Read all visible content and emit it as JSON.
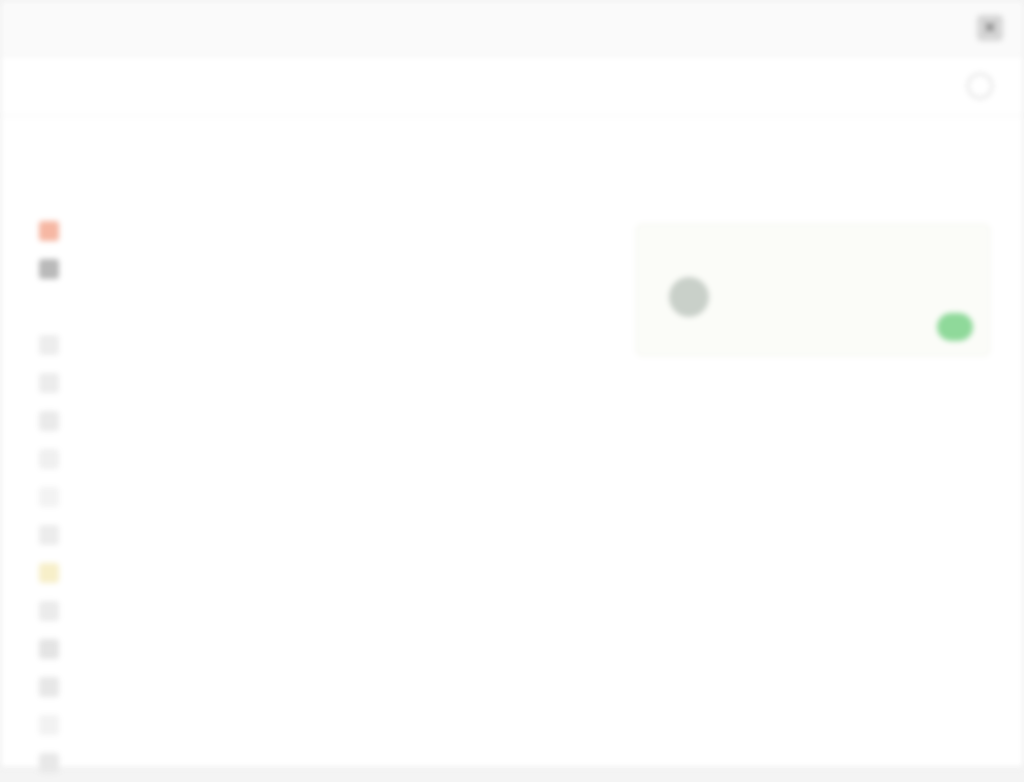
{
  "window": {
    "title": "",
    "close_glyph": "✕"
  },
  "header": {
    "title": "",
    "action": "",
    "icon": "user-circle-icon"
  },
  "sidebar": {
    "items": [
      {
        "label": "",
        "icon": "item-icon",
        "color": "#ffffff"
      },
      {
        "label": "",
        "icon": "item-icon",
        "color": "#ffffff"
      },
      {
        "label": "",
        "icon": "orange-icon",
        "color": "#f6b7a3"
      },
      {
        "label": "",
        "icon": "dark-icon",
        "color": "#b9b9b9"
      },
      {
        "label": "",
        "icon": "item-icon",
        "color": "#ffffff"
      },
      {
        "label": "",
        "icon": "item-icon",
        "color": "#ededed"
      },
      {
        "label": "",
        "icon": "item-icon",
        "color": "#ececec"
      },
      {
        "label": "",
        "icon": "item-icon",
        "color": "#eaeaea"
      },
      {
        "label": "",
        "icon": "item-icon",
        "color": "#f0f0f0"
      },
      {
        "label": "",
        "icon": "item-icon",
        "color": "#f3f3f3"
      },
      {
        "label": "",
        "icon": "item-icon",
        "color": "#ececec"
      },
      {
        "label": "",
        "icon": "yellow-icon",
        "color": "#f7efc9"
      },
      {
        "label": "",
        "icon": "item-icon",
        "color": "#ebebeb"
      },
      {
        "label": "",
        "icon": "item-icon",
        "color": "#e4e4e4"
      },
      {
        "label": "",
        "icon": "item-icon",
        "color": "#e7e7e7"
      },
      {
        "label": "",
        "icon": "item-icon",
        "color": "#f2f2f2"
      },
      {
        "label": "",
        "icon": "item-icon",
        "color": "#e8e8e8"
      }
    ]
  },
  "panel": {
    "title": "",
    "card": {
      "caption": "",
      "text": "",
      "meta": "",
      "accent": "#8fd99a"
    }
  },
  "details": {
    "rows": [
      {
        "k": "",
        "v": ""
      },
      {
        "k": "",
        "v": ""
      },
      {
        "k": "",
        "v": ""
      },
      {
        "k": "",
        "v": ""
      },
      {
        "k": "",
        "v": ""
      },
      {
        "k": "",
        "v": ""
      },
      {
        "k": "",
        "v": ""
      },
      {
        "k": "",
        "v": ""
      }
    ]
  }
}
